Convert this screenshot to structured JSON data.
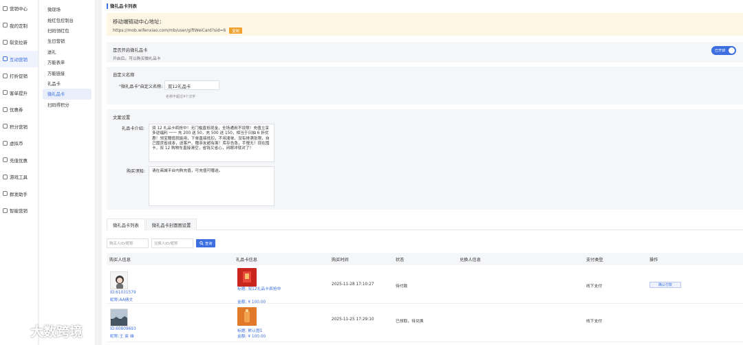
{
  "sidebar": {
    "items": [
      {
        "label": "营销中心",
        "active": false
      },
      {
        "label": "我的定制",
        "active": false
      },
      {
        "label": "裂变拉新",
        "active": false
      },
      {
        "label": "互动营销",
        "active": true
      },
      {
        "label": "打折促销",
        "active": false
      },
      {
        "label": "客单提升",
        "active": false
      },
      {
        "label": "优惠券",
        "active": false
      },
      {
        "label": "积分营销",
        "active": false
      },
      {
        "label": "虚拟币",
        "active": false
      },
      {
        "label": "充值优惠",
        "active": false
      },
      {
        "label": "游戏工具",
        "active": false
      },
      {
        "label": "群发助手",
        "active": false
      },
      {
        "label": "智能营销",
        "active": false
      }
    ]
  },
  "subnav": {
    "items": [
      {
        "label": "微现场",
        "active": false
      },
      {
        "label": "抢红包控制台",
        "active": false
      },
      {
        "label": "扫码领红包",
        "active": false
      },
      {
        "label": "生日营销",
        "active": false
      },
      {
        "label": "送礼",
        "active": false
      },
      {
        "label": "万能表单",
        "active": false
      },
      {
        "label": "万能链接",
        "active": false
      },
      {
        "label": "礼品卡",
        "active": false
      },
      {
        "label": "微礼品卡",
        "active": true
      },
      {
        "label": "扫码得积分",
        "active": false
      }
    ]
  },
  "page": {
    "title": "微礼品卡列表"
  },
  "notice": {
    "title": "移动端链动中心地址：",
    "url": "https://mob.wifenxiao.com/mb/user/giftWeiCard?sid=6",
    "copy_label": "复制"
  },
  "toggle_section": {
    "label": "是否开启微礼品卡",
    "sub": "开启后，可以购买微礼品卡",
    "toggle_label": "已开启",
    "enabled": true
  },
  "name_section": {
    "title": "自定义名称",
    "field_label": "\"微礼品卡\"自定义名称:",
    "value": "双12礼品卡",
    "hint": "名称不超过4个汉字"
  },
  "copy_section": {
    "title": "文案设置",
    "intro_label": "礼品卡介绍:",
    "intro_text": "双 12 礼品卡疯抢中！无门槛直抵现金，全场通用不设限！充值立享多逆福利 一一 充 200 送 50，充 500 送 150，相当于日抽 6 折优惠！领宝赠值就能用，下单直接抵扣，不用凑单、没有排满张限，自己囤货省成本，送客户、赠亲友超有面！库存告急，手慢无！现在囤卡，双 12 购物车直接清空，省钱又省心，闭眼冲就对了！",
    "notice_label": "购买须知:",
    "notice_text": "请在商城平台内购充值，可充值可赠送。"
  },
  "tabs": [
    {
      "label": "微礼品卡列表",
      "active": true
    },
    {
      "label": "微礼品卡封面图设置",
      "active": false
    }
  ],
  "search": {
    "buyer_placeholder": "购买人ID/昵称",
    "redeemer_placeholder": "兑换人ID/昵称",
    "button_label": "查询"
  },
  "table": {
    "headers": [
      "购买人信息",
      "礼品卡信息",
      "购买时间",
      "状态",
      "兑换人信息",
      "支付类型",
      "操作"
    ],
    "rows": [
      {
        "buyer_id": "ID:61031579",
        "buyer_nick": "昵称:AA倩文",
        "card_title": "标题: 双12礼品卡疯抢中",
        "card_amount": "金额: ¥ 100.00",
        "card_color": "#c8261c",
        "time": "2025-11-28 17:10:27",
        "status": "待付款",
        "redeemer": "",
        "pay_type": "线下支付",
        "action": "确认付款"
      },
      {
        "buyer_id": "ID:60809693",
        "buyer_nick": "昵称:王 英 雄",
        "card_title": "标题: 默认图1",
        "card_amount": "金额: ¥ 100.00",
        "card_color": "#e0792a",
        "time": "2025-11-25 17:29:10",
        "status": "已领取，待兑换",
        "redeemer": "",
        "pay_type": "线下支付",
        "action": ""
      }
    ]
  },
  "watermark": {
    "text": "大数跨境"
  }
}
